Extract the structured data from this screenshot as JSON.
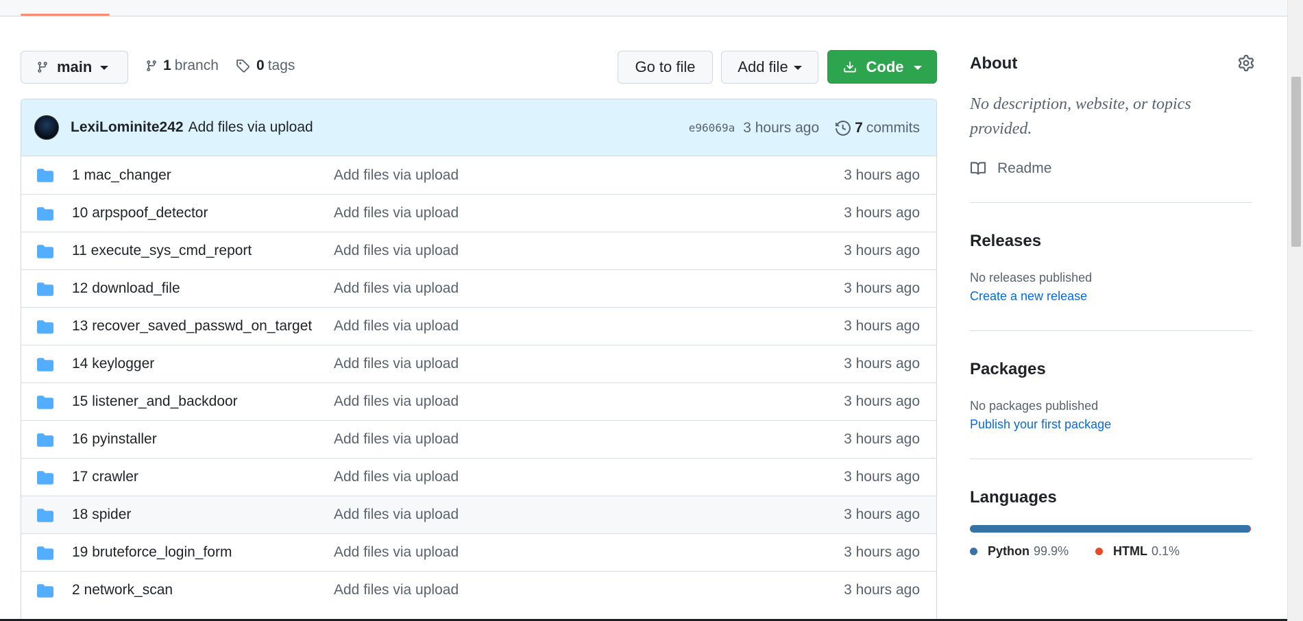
{
  "toolbar": {
    "branch_name": "main",
    "branch_count": "1",
    "branch_label": "branch",
    "tag_count": "0",
    "tag_label": "tags",
    "go_to_file": "Go to file",
    "add_file": "Add file",
    "code": "Code"
  },
  "commit": {
    "author": "LexiLominite242",
    "message": "Add files via upload",
    "sha": "e96069a",
    "time": "3 hours ago",
    "commit_count": "7",
    "commits_label": "commits"
  },
  "files": [
    {
      "name": "1 mac_changer",
      "message": "Add files via upload",
      "time": "3 hours ago"
    },
    {
      "name": "10 arpspoof_detector",
      "message": "Add files via upload",
      "time": "3 hours ago"
    },
    {
      "name": "11 execute_sys_cmd_report",
      "message": "Add files via upload",
      "time": "3 hours ago"
    },
    {
      "name": "12 download_file",
      "message": "Add files via upload",
      "time": "3 hours ago"
    },
    {
      "name": "13 recover_saved_passwd_on_target",
      "message": "Add files via upload",
      "time": "3 hours ago"
    },
    {
      "name": "14 keylogger",
      "message": "Add files via upload",
      "time": "3 hours ago"
    },
    {
      "name": "15 listener_and_backdoor",
      "message": "Add files via upload",
      "time": "3 hours ago"
    },
    {
      "name": "16 pyinstaller",
      "message": "Add files via upload",
      "time": "3 hours ago"
    },
    {
      "name": "17 crawler",
      "message": "Add files via upload",
      "time": "3 hours ago"
    },
    {
      "name": "18 spider",
      "message": "Add files via upload",
      "time": "3 hours ago"
    },
    {
      "name": "19 bruteforce_login_form",
      "message": "Add files via upload",
      "time": "3 hours ago"
    },
    {
      "name": "2 network_scan",
      "message": "Add files via upload",
      "time": "3 hours ago"
    }
  ],
  "sidebar": {
    "about_title": "About",
    "about_description": "No description, website, or topics provided.",
    "readme_label": "Readme",
    "releases_title": "Releases",
    "releases_text": "No releases published",
    "releases_link": "Create a new release",
    "packages_title": "Packages",
    "packages_text": "No packages published",
    "packages_link": "Publish your first package",
    "languages_title": "Languages",
    "languages": [
      {
        "name": "Python",
        "percent": "99.9%",
        "color": "#3572a5",
        "fraction": 0.999
      },
      {
        "name": "HTML",
        "percent": "0.1%",
        "color": "#e34c26",
        "fraction": 0.001
      }
    ]
  },
  "colors": {
    "primary_button": "#2da44e",
    "link": "#0969da",
    "folder": "#54aeff",
    "commit_header_bg": "#ddf4ff"
  }
}
